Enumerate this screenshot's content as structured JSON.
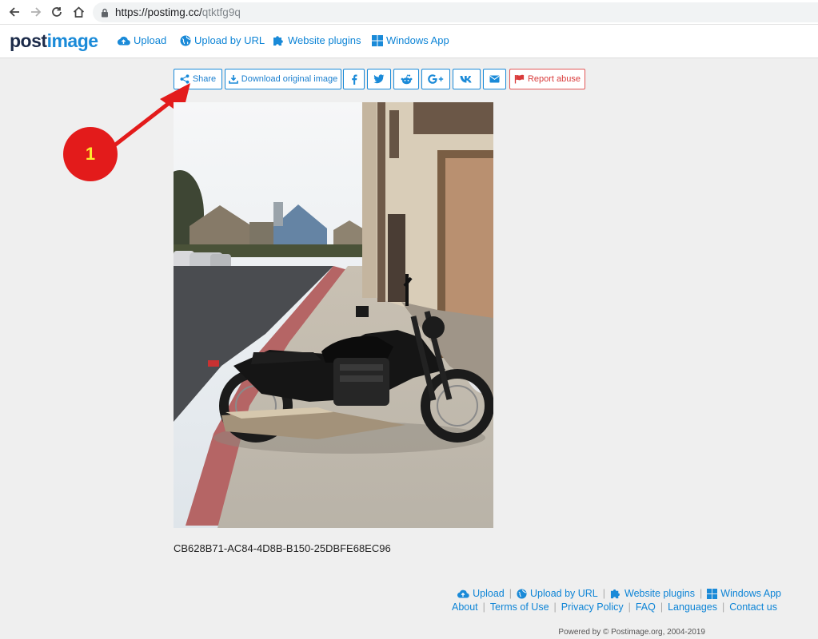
{
  "browser": {
    "url_host": "https://postimg.cc/",
    "url_path": "qtktfg9q"
  },
  "header": {
    "logo_a": "post",
    "logo_b": "image",
    "nav": [
      {
        "label": "Upload",
        "icon": "cloud-upload-icon"
      },
      {
        "label": "Upload by URL",
        "icon": "globe-icon"
      },
      {
        "label": "Website plugins",
        "icon": "puzzle-icon"
      },
      {
        "label": "Windows App",
        "icon": "windows-icon"
      }
    ]
  },
  "toolbar": {
    "share_label": "Share",
    "download_label": "Download original image",
    "report_label": "Report abuse",
    "social_icons": [
      "facebook-icon",
      "twitter-icon",
      "reddit-icon",
      "google-plus-icon",
      "vk-icon",
      "email-icon"
    ]
  },
  "annotation": {
    "badge": "1"
  },
  "image": {
    "caption": "CB628B71-AC84-4D8B-B150-25DBFE68EC96"
  },
  "footer": {
    "row1": [
      "Upload",
      "Upload by URL",
      "Website plugins",
      "Windows App"
    ],
    "row2": [
      "About",
      "Terms of Use",
      "Privacy Policy",
      "FAQ",
      "Languages",
      "Contact us"
    ],
    "powered": "Powered by © Postimage.org, 2004-2019"
  },
  "colors": {
    "accent": "#1a8ad8",
    "report": "#d93b3b",
    "annotation": "#e31b1b"
  }
}
